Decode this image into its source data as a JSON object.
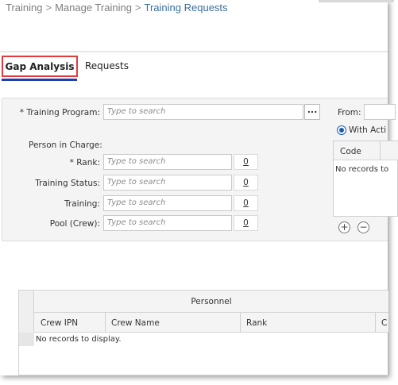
{
  "breadcrumb": {
    "items": [
      "Training",
      "Manage Training"
    ],
    "separator": ">",
    "current": "Training Requests"
  },
  "tabs": [
    {
      "label": "Gap Analysis",
      "active": true
    },
    {
      "label": "Requests",
      "active": false
    }
  ],
  "filters": {
    "training_program": {
      "label": "* Training Program:",
      "placeholder": "Type to search",
      "browse_label": "..."
    },
    "person_in_charge_label": "Person in Charge:",
    "rank": {
      "label": "* Rank:",
      "placeholder": "Type to search",
      "count": "0"
    },
    "training_status": {
      "label": "Training Status:",
      "placeholder": "Type to search",
      "count": "0"
    },
    "training": {
      "label": "Training:",
      "placeholder": "Type to search",
      "count": "0"
    },
    "pool": {
      "label": "Pool (Crew):",
      "placeholder": "Type to search",
      "count": "0"
    }
  },
  "right_panel": {
    "from_label": "From:",
    "radio_label": "With Acti",
    "grid_header": "Code",
    "grid_empty": "No records to",
    "add_symbol": "+",
    "remove_symbol": "−"
  },
  "personnel_grid": {
    "group_label": "Personnel",
    "columns": [
      "Crew IPN",
      "Crew Name",
      "Rank",
      "C"
    ],
    "empty_text": "No records to display."
  },
  "colors": {
    "active_tab_border": "#e23b3b",
    "active_tab_underline": "#1f3fae",
    "breadcrumb_current": "#3b6e9e",
    "radio_accent": "#1a5ab8"
  }
}
